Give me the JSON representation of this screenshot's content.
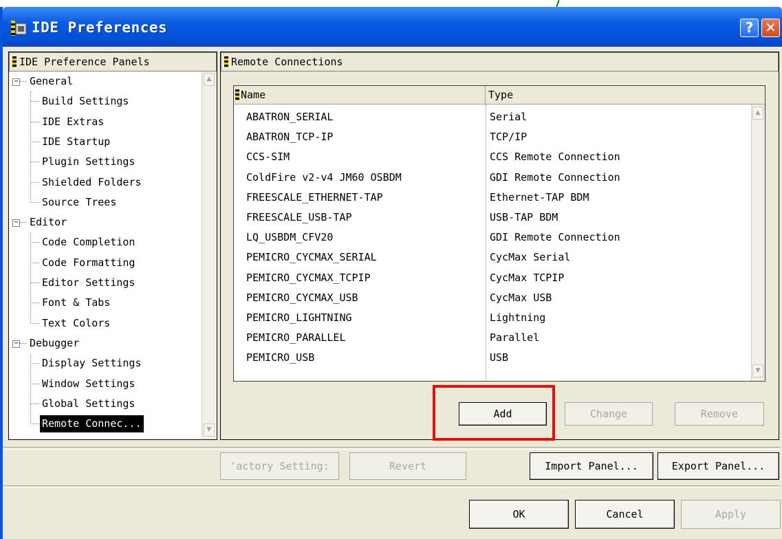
{
  "window": {
    "title": "IDE Preferences",
    "help_symbol": "?",
    "close_symbol": "✕"
  },
  "tree": {
    "header": "IDE Preference Panels",
    "expander_symbol": "−",
    "groups": [
      {
        "label": "General",
        "items": [
          "Build Settings",
          "IDE Extras",
          "IDE Startup",
          "Plugin Settings",
          "Shielded Folders",
          "Source Trees"
        ]
      },
      {
        "label": "Editor",
        "items": [
          "Code Completion",
          "Code Formatting",
          "Editor Settings",
          "Font & Tabs",
          "Text Colors"
        ]
      },
      {
        "label": "Debugger",
        "items": [
          "Display Settings",
          "Window Settings",
          "Global Settings",
          "Remote Connec..."
        ]
      }
    ],
    "selected_item": "Remote Connec..."
  },
  "panel": {
    "header": "Remote Connections",
    "columns": {
      "name": "Name",
      "type": "Type"
    },
    "rows": [
      {
        "name": "ABATRON_SERIAL",
        "type": "Serial"
      },
      {
        "name": "ABATRON_TCP-IP",
        "type": "TCP/IP"
      },
      {
        "name": "CCS-SIM",
        "type": "CCS Remote Connection"
      },
      {
        "name": "ColdFire v2-v4 JM60 OSBDM",
        "type": "GDI Remote Connection"
      },
      {
        "name": "FREESCALE_ETHERNET-TAP",
        "type": "Ethernet-TAP BDM"
      },
      {
        "name": "FREESCALE_USB-TAP",
        "type": "USB-TAP BDM"
      },
      {
        "name": "LQ_USBDM_CFV20",
        "type": "GDI Remote Connection"
      },
      {
        "name": "PEMICRO_CYCMAX_SERIAL",
        "type": "CycMax Serial"
      },
      {
        "name": "PEMICRO_CYCMAX_TCPIP",
        "type": "CycMax TCPIP"
      },
      {
        "name": "PEMICRO_CYCMAX_USB",
        "type": "CycMax USB"
      },
      {
        "name": "PEMICRO_LIGHTNING",
        "type": "Lightning"
      },
      {
        "name": "PEMICRO_PARALLEL",
        "type": "Parallel"
      },
      {
        "name": "PEMICRO_USB",
        "type": "USB"
      }
    ],
    "buttons": {
      "add": "Add",
      "change": "Change",
      "remove": "Remove"
    }
  },
  "bottom": {
    "factory_settings": "'actory Setting:",
    "revert": "Revert",
    "import_panel": "Import Panel...",
    "export_panel": "Export Panel...",
    "ok": "OK",
    "cancel": "Cancel",
    "apply": "Apply"
  },
  "colors": {
    "titlebar": "#0a5ae2",
    "highlight_box": "#e01010",
    "dialog_bg": "#ece9d8"
  },
  "icons": {
    "scroll_up": "▲",
    "scroll_down": "▼"
  }
}
